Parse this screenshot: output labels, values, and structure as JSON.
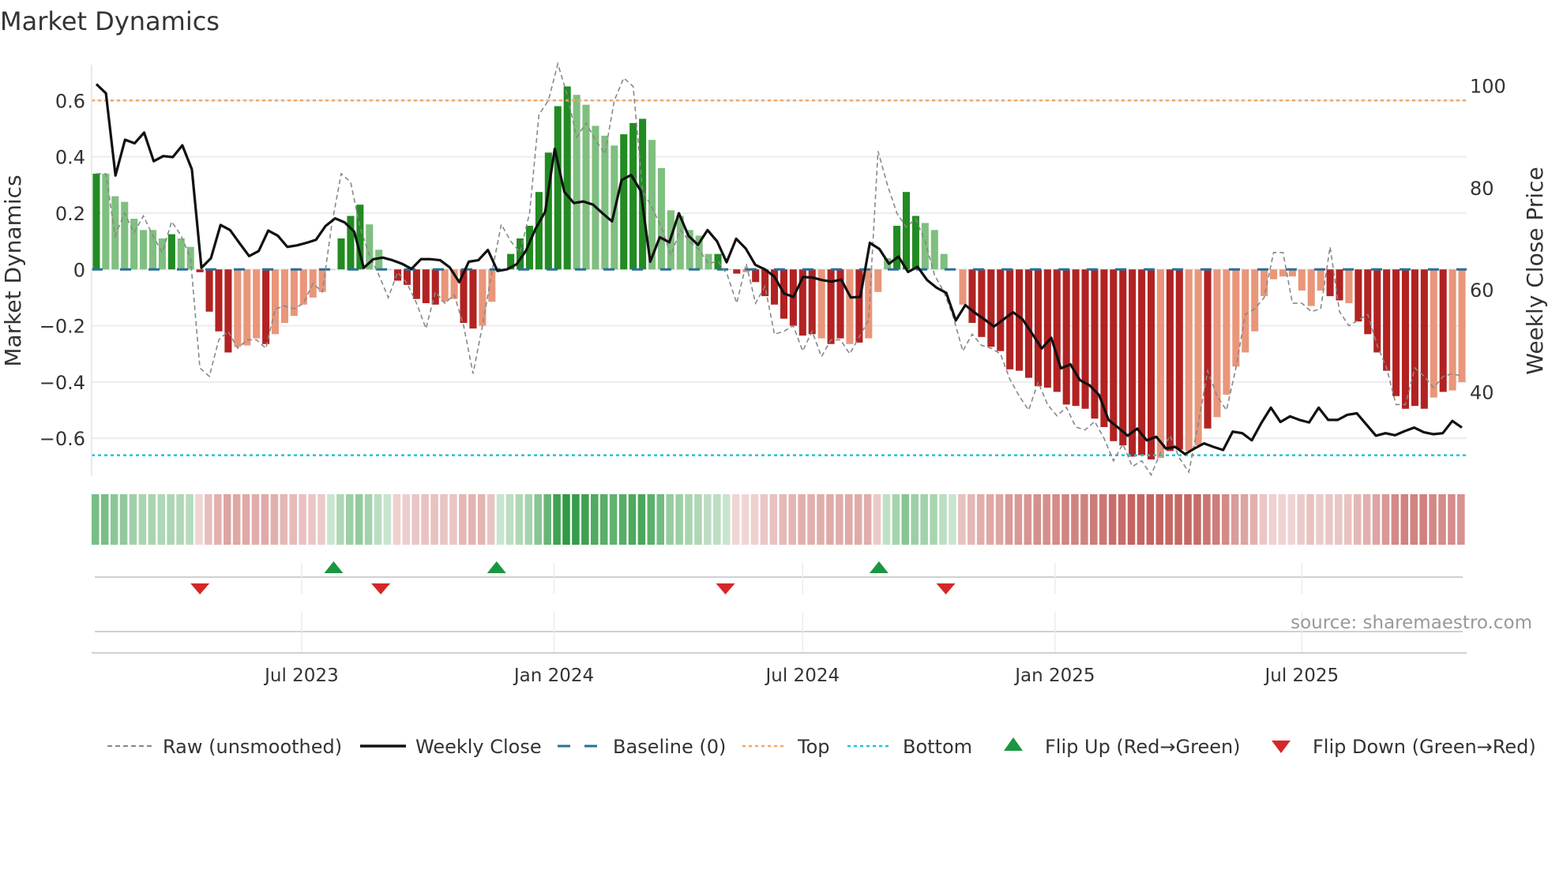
{
  "title": "Market Dynamics",
  "source": "source: sharemaestro.com",
  "colors": {
    "bar_strong_pos": "#228b22",
    "bar_weak_pos": "#7fbf7f",
    "bar_strong_neg": "#b22222",
    "bar_weak_neg": "#e9967a",
    "raw": "#888888",
    "close": "#111111",
    "baseline": "#2a6f97",
    "top": "#f0a868",
    "bottom": "#22c3d6",
    "flip_up": "#1a9641",
    "flip_down": "#d62728"
  },
  "chart_data": {
    "type": "bar",
    "title": "Market Dynamics",
    "ylabel": "Market Dynamics",
    "y2label": "Weekly Close Price",
    "ylim": [
      -0.734,
      0.727
    ],
    "y2lim": [
      23.5,
      104.1
    ],
    "yticks": [
      {
        "v": 0.6,
        "label": "0.6"
      },
      {
        "v": 0.4,
        "label": "0.4"
      },
      {
        "v": 0.2,
        "label": "0.2"
      },
      {
        "v": 0,
        "label": "0"
      },
      {
        "v": -0.2,
        "label": "−0.2"
      },
      {
        "v": -0.4,
        "label": "−0.4"
      },
      {
        "v": -0.6,
        "label": "−0.6"
      }
    ],
    "y2ticks": [
      {
        "v": 100,
        "label": "100"
      },
      {
        "v": 80,
        "label": "80"
      },
      {
        "v": 60,
        "label": "60"
      },
      {
        "v": 40,
        "label": "40"
      }
    ],
    "xticks": [
      {
        "week": 21.8,
        "label": "Jul 2023"
      },
      {
        "week": 48.6,
        "label": "Jan 2024"
      },
      {
        "week": 75,
        "label": "Jul 2024"
      },
      {
        "week": 101.8,
        "label": "Jan 2025"
      },
      {
        "week": 128,
        "label": "Jul 2025"
      }
    ],
    "top_level": 0.6,
    "bottom_level": -0.66,
    "baseline": 0,
    "values": [
      0.34,
      0.34,
      0.26,
      0.24,
      0.18,
      0.14,
      0.14,
      0.11,
      0.125,
      0.11,
      0.08,
      -0.01,
      -0.15,
      -0.22,
      -0.295,
      -0.275,
      -0.27,
      -0.245,
      -0.265,
      -0.23,
      -0.19,
      -0.165,
      -0.125,
      -0.1,
      -0.08,
      0,
      0.11,
      0.19,
      0.23,
      0.16,
      0.07,
      0,
      -0.04,
      -0.055,
      -0.105,
      -0.12,
      -0.125,
      -0.115,
      -0.105,
      -0.19,
      -0.21,
      -0.2,
      -0.115,
      0,
      0.055,
      0.11,
      0.155,
      0.275,
      0.415,
      0.58,
      0.65,
      0.62,
      0.585,
      0.51,
      0.475,
      0.44,
      0.48,
      0.52,
      0.535,
      0.46,
      0.36,
      0.21,
      0.19,
      0.14,
      0.12,
      0.055,
      0.055,
      0,
      -0.015,
      -0.01,
      -0.045,
      -0.095,
      -0.125,
      -0.175,
      -0.2,
      -0.235,
      -0.23,
      -0.245,
      -0.265,
      -0.245,
      -0.265,
      -0.26,
      -0.245,
      -0.08,
      0.04,
      0.155,
      0.275,
      0.19,
      0.165,
      0.14,
      0.055,
      0,
      -0.125,
      -0.19,
      -0.24,
      -0.275,
      -0.29,
      -0.355,
      -0.36,
      -0.385,
      -0.415,
      -0.42,
      -0.435,
      -0.48,
      -0.485,
      -0.495,
      -0.53,
      -0.56,
      -0.61,
      -0.625,
      -0.665,
      -0.66,
      -0.675,
      -0.67,
      -0.645,
      -0.64,
      -0.645,
      -0.625,
      -0.565,
      -0.525,
      -0.445,
      -0.345,
      -0.295,
      -0.22,
      -0.095,
      -0.035,
      -0.025,
      -0.025,
      -0.075,
      -0.13,
      -0.075,
      -0.095,
      -0.11,
      -0.12,
      -0.185,
      -0.23,
      -0.295,
      -0.36,
      -0.45,
      -0.495,
      -0.485,
      -0.495,
      -0.455,
      -0.435,
      -0.43,
      -0.4
    ],
    "strength": "SLLLLLLLSLLSSSSLLLSLLLLLLLSSSLLLSSSSSLLSSLLLSSSSSSSLLLLLSSSLLLLLLLSLSLSSSSSSSLSSLSLLLSSSLLLLLSSSSSSSSSSSSSSSSSSSSLSSLLSLLLLLLLLLLLLSSLSSSSSSSSLSLLLL",
    "raw": [
      0.34,
      0.34,
      0.12,
      0.2,
      0.13,
      0.19,
      0.12,
      0.06,
      0.17,
      0.12,
      0.04,
      -0.35,
      -0.38,
      -0.25,
      -0.22,
      -0.28,
      -0.25,
      -0.25,
      -0.28,
      -0.14,
      -0.13,
      -0.14,
      -0.12,
      -0.05,
      -0.08,
      0.16,
      0.34,
      0.31,
      0.15,
      0.05,
      -0.02,
      -0.1,
      -0.01,
      -0.05,
      -0.12,
      -0.21,
      -0.08,
      -0.12,
      -0.09,
      -0.2,
      -0.37,
      -0.2,
      -0.01,
      0.16,
      0.1,
      0.06,
      0.2,
      0.55,
      0.6,
      0.73,
      0.62,
      0.47,
      0.52,
      0.46,
      0.41,
      0.6,
      0.68,
      0.65,
      0.28,
      0.22,
      0.15,
      0.05,
      0.14,
      0.1,
      0.07,
      0.02,
      0.03,
      -0.02,
      -0.12,
      0.02,
      -0.12,
      -0.06,
      -0.23,
      -0.22,
      -0.2,
      -0.29,
      -0.22,
      -0.31,
      -0.25,
      -0.25,
      -0.3,
      -0.24,
      -0.18,
      0.42,
      0.3,
      0.2,
      0.15,
      0.18,
      0.1,
      -0.02,
      -0.08,
      -0.17,
      -0.29,
      -0.23,
      -0.27,
      -0.28,
      -0.3,
      -0.39,
      -0.45,
      -0.5,
      -0.4,
      -0.48,
      -0.52,
      -0.49,
      -0.56,
      -0.57,
      -0.54,
      -0.6,
      -0.68,
      -0.62,
      -0.7,
      -0.68,
      -0.73,
      -0.65,
      -0.59,
      -0.67,
      -0.72,
      -0.55,
      -0.36,
      -0.45,
      -0.5,
      -0.35,
      -0.16,
      -0.14,
      -0.1,
      0.06,
      0.06,
      -0.12,
      -0.12,
      -0.15,
      -0.14,
      0.08,
      -0.15,
      -0.2,
      -0.18,
      -0.16,
      -0.27,
      -0.35,
      -0.48,
      -0.48,
      -0.35,
      -0.38,
      -0.42,
      -0.38,
      -0.37,
      -0.38
    ],
    "close": [
      100.3,
      98.5,
      82.4,
      89.4,
      88.7,
      90.8,
      85.2,
      86.2,
      86,
      88.3,
      83.6,
      64.3,
      66.2,
      72.7,
      71.7,
      69.1,
      66.6,
      67.6,
      71.6,
      70.6,
      68.4,
      68.7,
      69.2,
      69.8,
      72.5,
      74,
      73.2,
      71.4,
      64.3,
      66,
      66.3,
      65.8,
      65.1,
      64.1,
      66,
      66,
      65.8,
      64.4,
      61.5,
      65.5,
      65.8,
      67.8,
      63.7,
      64,
      65,
      67.7,
      72,
      75.3,
      87.6,
      79.2,
      77,
      77.3,
      76.7,
      75,
      73.4,
      81.5,
      82.5,
      79.4,
      65.5,
      70.3,
      69.3,
      75,
      70.6,
      68.8,
      71.7,
      69.5,
      65.4,
      70,
      68.1,
      64.9,
      64,
      62.6,
      59.3,
      58.6,
      62.5,
      62.4,
      61.9,
      61.6,
      62,
      58.5,
      58.6,
      69.2,
      68,
      65.1,
      66.5,
      63.5,
      64.5,
      61.9,
      60.4,
      59.4,
      54,
      57,
      55.5,
      54.2,
      52.8,
      54.2,
      55.6,
      54.2,
      51.4,
      48.5,
      50.6,
      44.6,
      45.4,
      42.3,
      41.3,
      39.4,
      34.5,
      33,
      31.4,
      32.8,
      30.5,
      31.2,
      28.9,
      29.2,
      27.8,
      28.9,
      29.9,
      29.2,
      28.6,
      32.2,
      31.9,
      30.5,
      33.9,
      36.9,
      34.1,
      35.2,
      34.5,
      34,
      36.9,
      34.5,
      34.5,
      35.5,
      35.8,
      33.6,
      31.4,
      31.9,
      31.5,
      32.3,
      33,
      32.1,
      31.7,
      31.9,
      34.3,
      33
    ],
    "flips": [
      {
        "week": 11,
        "type": "down"
      },
      {
        "week": 25.2,
        "type": "up"
      },
      {
        "week": 30.2,
        "type": "down"
      },
      {
        "week": 42.5,
        "type": "up"
      },
      {
        "week": 66.8,
        "type": "down"
      },
      {
        "week": 83.1,
        "type": "up"
      },
      {
        "week": 90.2,
        "type": "down"
      }
    ],
    "legend": [
      {
        "key": "raw",
        "label": "Raw (unsmoothed)"
      },
      {
        "key": "close",
        "label": "Weekly Close"
      },
      {
        "key": "baseline",
        "label": "Baseline (0)"
      },
      {
        "key": "top",
        "label": "Top"
      },
      {
        "key": "bottom",
        "label": "Bottom"
      },
      {
        "key": "flip_up",
        "label": "Flip Up (Red→Green)"
      },
      {
        "key": "flip_down",
        "label": "Flip Down (Green→Red)"
      }
    ],
    "legend_position": "bottom"
  }
}
